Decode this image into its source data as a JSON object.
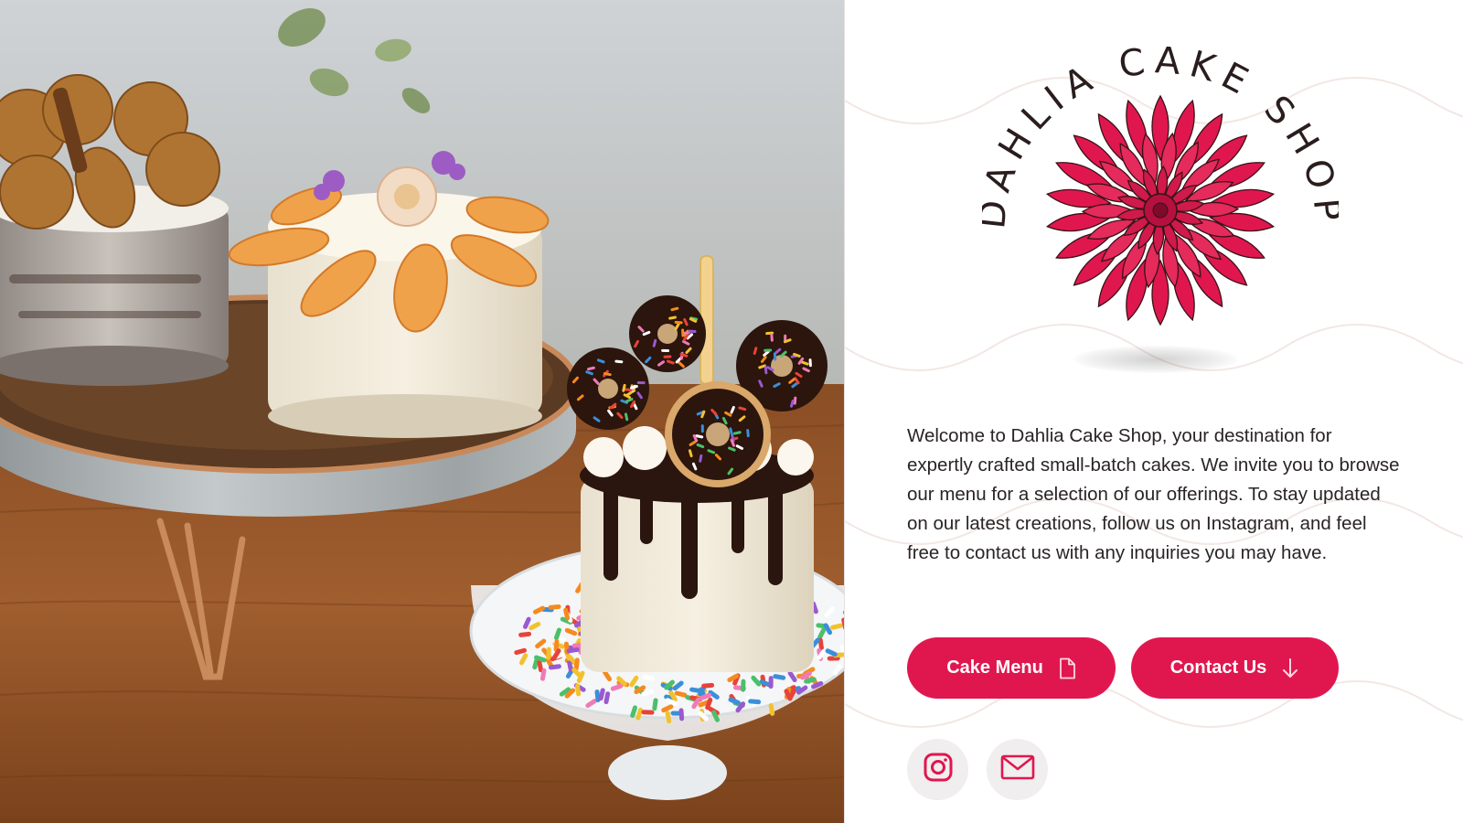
{
  "brand": {
    "name": "DAHLIA CAKE SHOP",
    "accent_color": "#e0174f",
    "text_color": "#2a2425"
  },
  "hero": {
    "description_icon": "cake-photo"
  },
  "intro": {
    "text": "Welcome to Dahlia Cake Shop, your destination for expertly crafted small-batch cakes. We invite you to browse our menu for a selection of our offerings. To stay updated on our latest creations, follow us on Instagram, and feel free to contact us with any inquiries you may have."
  },
  "actions": {
    "cake_menu_label": "Cake Menu",
    "cake_menu_icon": "document-icon",
    "contact_label": "Contact Us",
    "contact_icon": "arrow-down-icon"
  },
  "social": [
    {
      "name": "instagram",
      "icon": "instagram-icon"
    },
    {
      "name": "email",
      "icon": "mail-icon"
    }
  ]
}
